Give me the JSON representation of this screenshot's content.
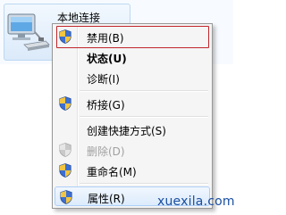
{
  "explorer_item": {
    "name": "本地连接",
    "icon": "network-adapter-icon"
  },
  "context_menu": {
    "items": [
      {
        "label": "禁用(B)",
        "icon": "uac-shield-icon",
        "state": "highlighted"
      },
      {
        "label": "状态(U)",
        "icon": "",
        "state": "default-bold"
      },
      {
        "label": "诊断(I)",
        "icon": "",
        "state": "normal"
      },
      {
        "label": "桥接(G)",
        "icon": "uac-shield-icon",
        "state": "normal"
      },
      {
        "label": "创建快捷方式(S)",
        "icon": "",
        "state": "normal"
      },
      {
        "label": "删除(D)",
        "icon": "uac-shield-icon",
        "state": "disabled"
      },
      {
        "label": "重命名(M)",
        "icon": "uac-shield-icon",
        "state": "normal"
      },
      {
        "label": "属性(R)",
        "icon": "uac-shield-icon",
        "state": "hover"
      }
    ]
  },
  "watermark": "xuexila.com",
  "colors": {
    "highlight_border": "#c0262c",
    "hover_fill": "#dcebfc",
    "watermark": "#1a4fa0"
  }
}
